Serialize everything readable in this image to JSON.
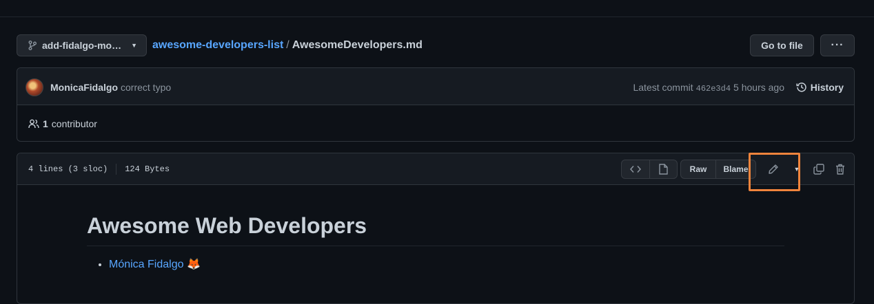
{
  "branch": {
    "label": "add-fidalgo-mo…"
  },
  "breadcrumb": {
    "repo": "awesome-developers-list",
    "separator": "/",
    "file": "AwesomeDevelopers.md"
  },
  "header_buttons": {
    "go_to_file": "Go to file",
    "more": "···"
  },
  "commit": {
    "author": "MonicaFidalgo",
    "message": "correct typo",
    "latest_label": "Latest commit",
    "sha": "462e3d4",
    "time": "5 hours ago",
    "history_label": "History"
  },
  "contributors": {
    "count": "1",
    "label": "contributor"
  },
  "file": {
    "lines": "4 lines (3 sloc)",
    "size": "124 Bytes",
    "raw_label": "Raw",
    "blame_label": "Blame"
  },
  "readme": {
    "heading": "Awesome Web Developers",
    "items": [
      {
        "name": "Mónica Fidalgo",
        "emoji": "🦊"
      }
    ]
  },
  "colors": {
    "accent": "#58a6ff",
    "highlight": "#f0843c",
    "bg": "#0d1117"
  }
}
